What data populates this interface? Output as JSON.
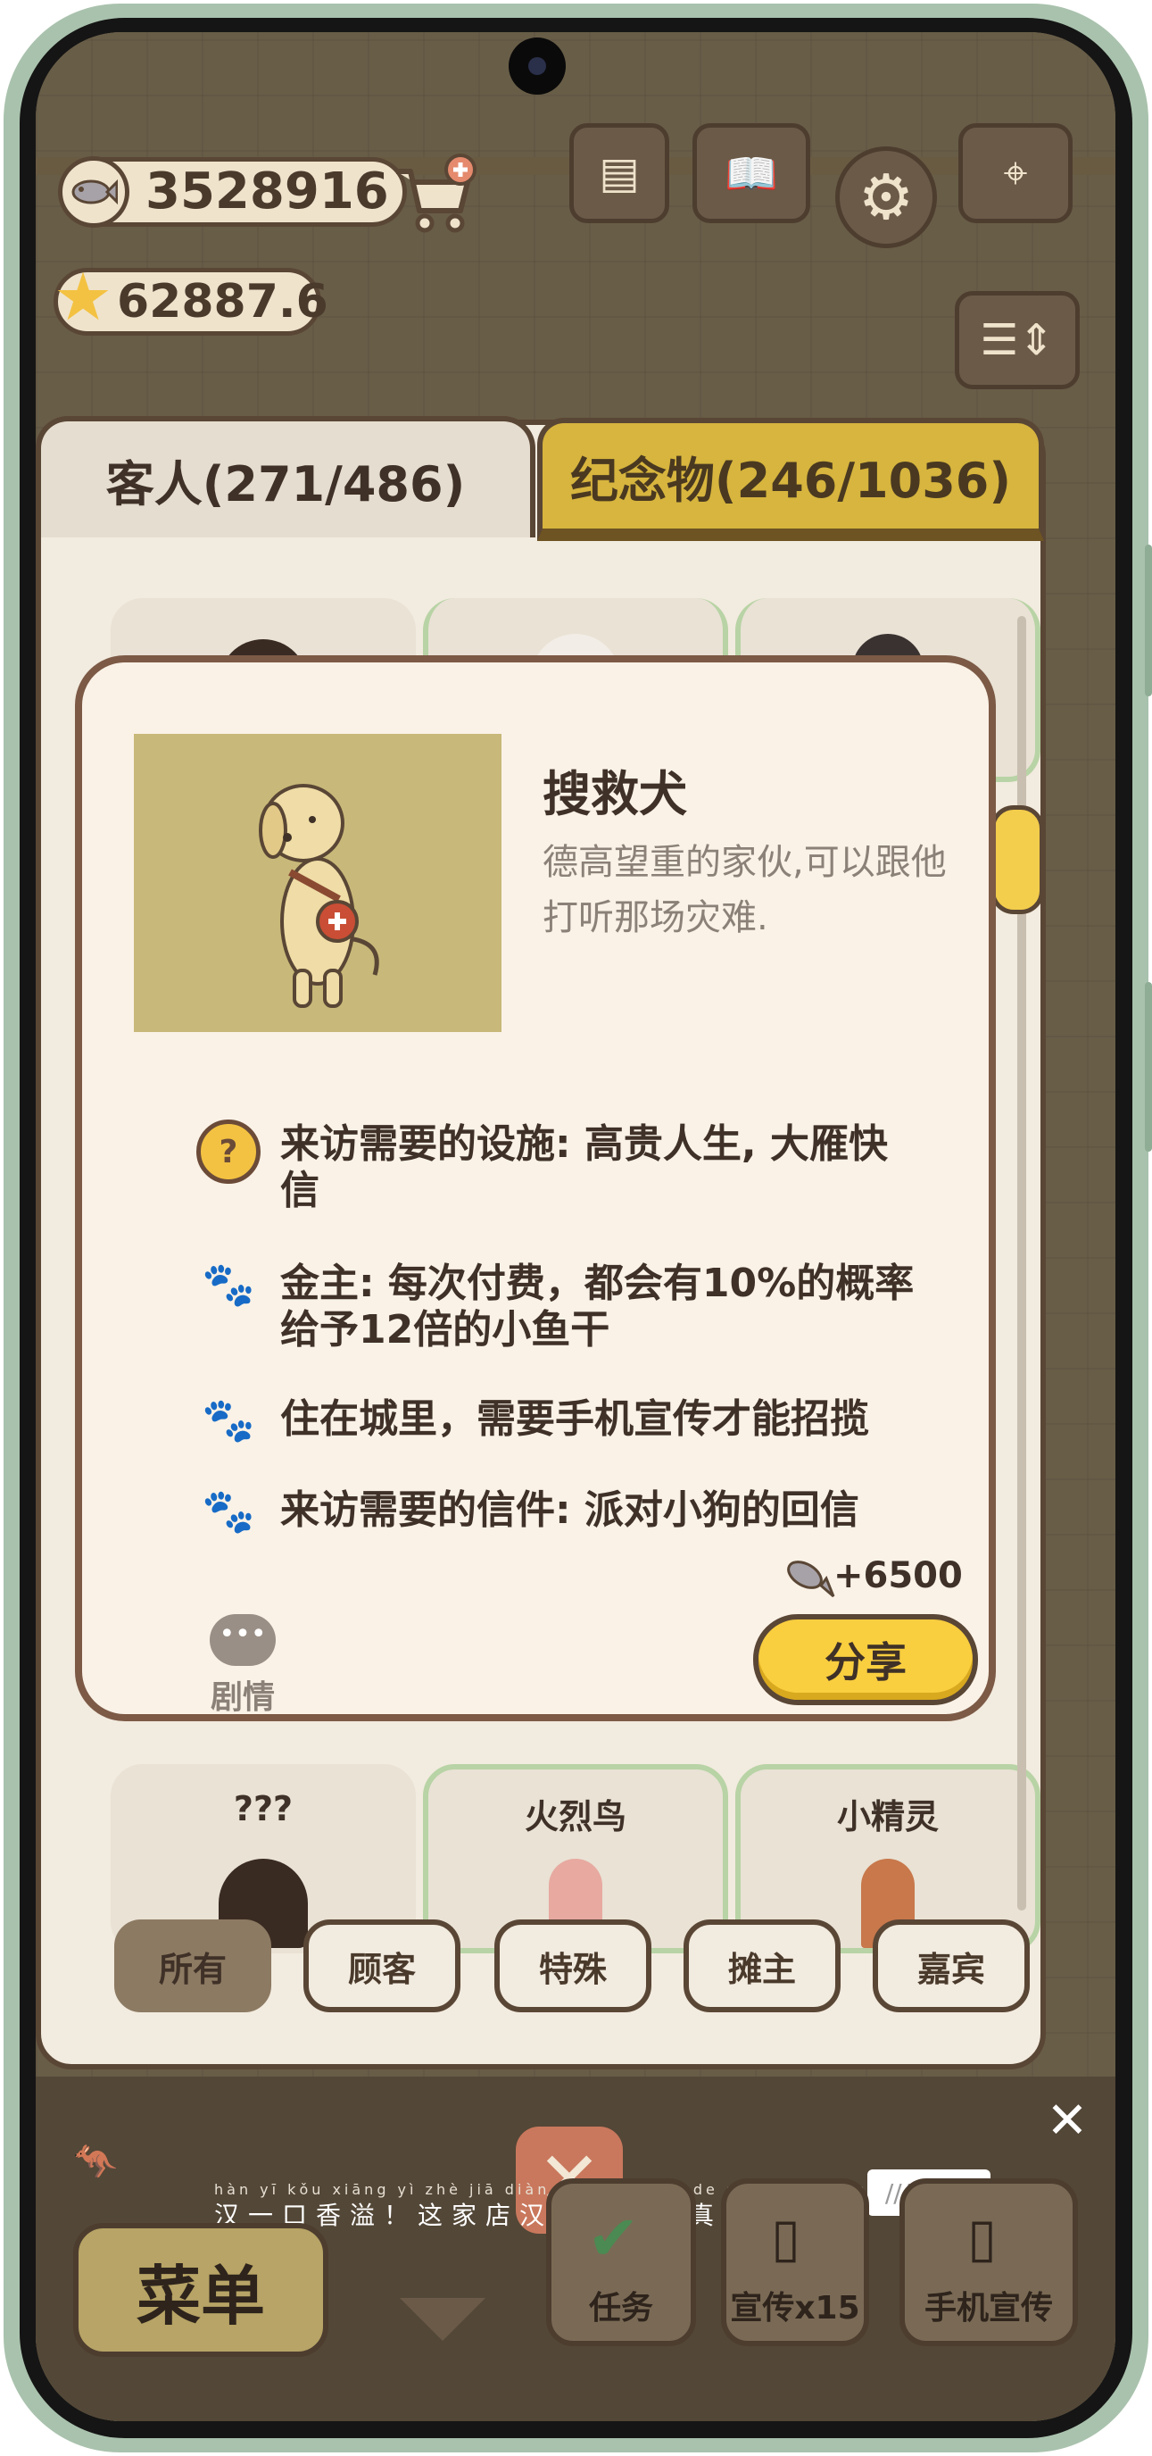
{
  "hud": {
    "fish_count": "3528916",
    "star_count": "62887.6"
  },
  "tabs": {
    "guests_label": "客人(271/486)",
    "souvenirs_label": "纪念物(246/1036)"
  },
  "grid_bottom": [
    {
      "label": "???"
    },
    {
      "label": "火烈鸟"
    },
    {
      "label": "小精灵"
    }
  ],
  "filters": [
    "所有",
    "顾客",
    "特殊",
    "摊主",
    "嘉宾"
  ],
  "detail": {
    "name": "搜救犬",
    "description": "德高望重的家伙,可以跟他打听那场灾难.",
    "requirements": [
      {
        "icon": "question-icon",
        "text": "来访需要的设施: 高贵人生, 大雁快信"
      },
      {
        "icon": "paw-icon",
        "text": "金主: 每次付费，都会有10%的概率给予12倍的小鱼干"
      },
      {
        "icon": "paw-icon",
        "text": "住在城里，需要手机宣传才能招揽"
      },
      {
        "icon": "paw-icon",
        "text": "来访需要的信件: 派对小狗的回信"
      }
    ],
    "reward": "+6500",
    "story_label": "剧情",
    "share_label": "分享"
  },
  "ad": {
    "pinyin": "hàn yī kǒu xiāng yì  zhè jiā diàn hàn bǎo zuò de shì zhēn de hǎo chī",
    "text": "汉一口香溢！这家店汉堡做的是真的好吃！",
    "badge": "广告"
  },
  "bottom_bar": {
    "menu_label": "菜单",
    "task_label": "任务",
    "promo_label": "宣传x15",
    "phone_promo_label": "手机宣传"
  },
  "colors": {
    "accent_yellow": "#f9ce3f",
    "panel_border": "#5a4635",
    "modal_bg": "#faf2e7"
  }
}
